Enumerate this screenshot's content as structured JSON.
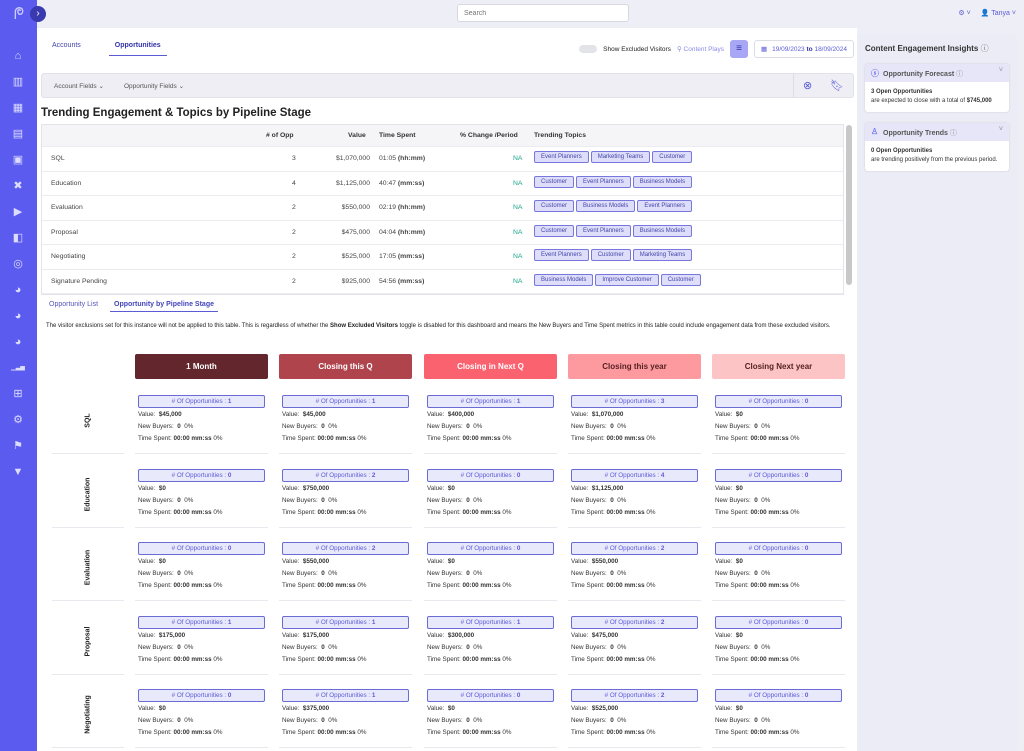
{
  "topbar": {
    "search_placeholder": "Search",
    "user": "Tanya"
  },
  "tabs": [
    {
      "label": "Accounts"
    },
    {
      "label": "Opportunities"
    }
  ],
  "toolbar": {
    "toggle_label": "Show Excluded Visitors",
    "content_plays": "Content Plays",
    "date_from": "19/09/2023",
    "date_to_word": "to",
    "date_to": "18/09/2024"
  },
  "fields": {
    "account": "Account Fields",
    "opportunity": "Opportunity Fields"
  },
  "section_title": "Trending Engagement & Topics by Pipeline Stage",
  "trend_table": {
    "headers": {
      "opp": "# of Opp",
      "value": "Value",
      "time": "Time Spent",
      "change": "% Change /Period",
      "topics": "Trending Topics"
    },
    "rows": [
      {
        "stage": "SQL",
        "opp": "3",
        "value": "$1,070,000",
        "time": "01:05",
        "unit": "(hh:mm)",
        "change": "NA",
        "topics": [
          "Event Planners",
          "Marketing Teams",
          "Customer"
        ]
      },
      {
        "stage": "Education",
        "opp": "4",
        "value": "$1,125,000",
        "time": "40:47",
        "unit": "(mm:ss)",
        "change": "NA",
        "topics": [
          "Customer",
          "Event Planners",
          "Business Models"
        ]
      },
      {
        "stage": "Evaluation",
        "opp": "2",
        "value": "$550,000",
        "time": "02:19",
        "unit": "(hh:mm)",
        "change": "NA",
        "topics": [
          "Customer",
          "Business Models",
          "Event Planners"
        ]
      },
      {
        "stage": "Proposal",
        "opp": "2",
        "value": "$475,000",
        "time": "04:04",
        "unit": "(hh:mm)",
        "change": "NA",
        "topics": [
          "Customer",
          "Event Planners",
          "Business Models"
        ]
      },
      {
        "stage": "Negotiating",
        "opp": "2",
        "value": "$525,000",
        "time": "17:05",
        "unit": "(mm:ss)",
        "change": "NA",
        "topics": [
          "Event Planners",
          "Customer",
          "Marketing Teams"
        ]
      },
      {
        "stage": "Signature Pending",
        "opp": "2",
        "value": "$925,000",
        "time": "54:56",
        "unit": "(mm:ss)",
        "change": "NA",
        "topics": [
          "Business Models",
          "Improve Customer",
          "Customer"
        ]
      }
    ]
  },
  "subtabs": [
    {
      "label": "Opportunity List"
    },
    {
      "label": "Opportunity by Pipeline Stage"
    }
  ],
  "notice": {
    "pre": "The visitor exclusions set for this instance will not be applied to this table. This is regardless of whether the ",
    "bold": "Show Excluded Visitors",
    "post": " toggle is disabled for this dashboard and means the New Buyers and Time Spent metrics in this table could include engagement data from these excluded visitors."
  },
  "pipeline": {
    "labels": {
      "opps": "# Of Opportunities : ",
      "value": "Value:",
      "buyers": "New Buyers:",
      "time": "Time Spent:"
    },
    "columns": [
      {
        "label": "1 Month",
        "bg": "#62262c",
        "fg": "#ffffff"
      },
      {
        "label": "Closing this Q",
        "bg": "#b0444d",
        "fg": "#ffffff"
      },
      {
        "label": "Closing in Next Q",
        "bg": "#fb6270",
        "fg": "#ffffff"
      },
      {
        "label": "Closing this year",
        "bg": "#fd9aa0",
        "fg": "#552222"
      },
      {
        "label": "Closing Next year",
        "bg": "#fdc4c6",
        "fg": "#552222"
      }
    ],
    "rows": [
      {
        "stage": "SQL",
        "cells": [
          {
            "opps": "1",
            "value": "$45,000",
            "buyers": "0",
            "buyers_pct": "0%",
            "time": "00:00 mm:ss",
            "time_pct": "0%"
          },
          {
            "opps": "1",
            "value": "$45,000",
            "buyers": "0",
            "buyers_pct": "0%",
            "time": "00:00 mm:ss",
            "time_pct": "0%"
          },
          {
            "opps": "1",
            "value": "$400,000",
            "buyers": "0",
            "buyers_pct": "0%",
            "time": "00:00 mm:ss",
            "time_pct": "0%"
          },
          {
            "opps": "3",
            "value": "$1,070,000",
            "buyers": "0",
            "buyers_pct": "0%",
            "time": "00:00 mm:ss",
            "time_pct": "0%"
          },
          {
            "opps": "0",
            "value": "$0",
            "buyers": "0",
            "buyers_pct": "0%",
            "time": "00:00 mm:ss",
            "time_pct": "0%"
          }
        ]
      },
      {
        "stage": "Education",
        "cells": [
          {
            "opps": "0",
            "value": "$0",
            "buyers": "0",
            "buyers_pct": "0%",
            "time": "00:00 mm:ss",
            "time_pct": "0%"
          },
          {
            "opps": "2",
            "value": "$750,000",
            "buyers": "0",
            "buyers_pct": "0%",
            "time": "00:00 mm:ss",
            "time_pct": "0%"
          },
          {
            "opps": "0",
            "value": "$0",
            "buyers": "0",
            "buyers_pct": "0%",
            "time": "00:00 mm:ss",
            "time_pct": "0%"
          },
          {
            "opps": "4",
            "value": "$1,125,000",
            "buyers": "0",
            "buyers_pct": "0%",
            "time": "00:00 mm:ss",
            "time_pct": "0%"
          },
          {
            "opps": "0",
            "value": "$0",
            "buyers": "0",
            "buyers_pct": "0%",
            "time": "00:00 mm:ss",
            "time_pct": "0%"
          }
        ]
      },
      {
        "stage": "Evaluation",
        "cells": [
          {
            "opps": "0",
            "value": "$0",
            "buyers": "0",
            "buyers_pct": "0%",
            "time": "00:00 mm:ss",
            "time_pct": "0%"
          },
          {
            "opps": "2",
            "value": "$550,000",
            "buyers": "0",
            "buyers_pct": "0%",
            "time": "00:00 mm:ss",
            "time_pct": "0%"
          },
          {
            "opps": "0",
            "value": "$0",
            "buyers": "0",
            "buyers_pct": "0%",
            "time": "00:00 mm:ss",
            "time_pct": "0%"
          },
          {
            "opps": "2",
            "value": "$550,000",
            "buyers": "0",
            "buyers_pct": "0%",
            "time": "00:00 mm:ss",
            "time_pct": "0%"
          },
          {
            "opps": "0",
            "value": "$0",
            "buyers": "0",
            "buyers_pct": "0%",
            "time": "00:00 mm:ss",
            "time_pct": "0%"
          }
        ]
      },
      {
        "stage": "Proposal",
        "cells": [
          {
            "opps": "1",
            "value": "$175,000",
            "buyers": "0",
            "buyers_pct": "0%",
            "time": "00:00 mm:ss",
            "time_pct": "0%"
          },
          {
            "opps": "1",
            "value": "$175,000",
            "buyers": "0",
            "buyers_pct": "0%",
            "time": "00:00 mm:ss",
            "time_pct": "0%"
          },
          {
            "opps": "1",
            "value": "$300,000",
            "buyers": "0",
            "buyers_pct": "0%",
            "time": "00:00 mm:ss",
            "time_pct": "0%"
          },
          {
            "opps": "2",
            "value": "$475,000",
            "buyers": "0",
            "buyers_pct": "0%",
            "time": "00:00 mm:ss",
            "time_pct": "0%"
          },
          {
            "opps": "0",
            "value": "$0",
            "buyers": "0",
            "buyers_pct": "0%",
            "time": "00:00 mm:ss",
            "time_pct": "0%"
          }
        ]
      },
      {
        "stage": "Negotiating",
        "cells": [
          {
            "opps": "0",
            "value": "$0",
            "buyers": "0",
            "buyers_pct": "0%",
            "time": "00:00 mm:ss",
            "time_pct": "0%"
          },
          {
            "opps": "1",
            "value": "$375,000",
            "buyers": "0",
            "buyers_pct": "0%",
            "time": "00:00 mm:ss",
            "time_pct": "0%"
          },
          {
            "opps": "0",
            "value": "$0",
            "buyers": "0",
            "buyers_pct": "0%",
            "time": "00:00 mm:ss",
            "time_pct": "0%"
          },
          {
            "opps": "2",
            "value": "$525,000",
            "buyers": "0",
            "buyers_pct": "0%",
            "time": "00:00 mm:ss",
            "time_pct": "0%"
          },
          {
            "opps": "0",
            "value": "$0",
            "buyers": "0",
            "buyers_pct": "0%",
            "time": "00:00 mm:ss",
            "time_pct": "0%"
          }
        ]
      }
    ]
  },
  "insights": {
    "title": "Content Engagement Insights",
    "forecast": {
      "title": "Opportunity Forecast",
      "bold": "3 Open Opportunities",
      "text": "are expected to close with a total of ",
      "amount": "$745,000"
    },
    "trends": {
      "title": "Opportunity Trends",
      "bold": "0 Open Opportunities",
      "text": "are trending positively from the previous period."
    }
  },
  "icons": {
    "sidebar": [
      "home-icon",
      "buildings-icon",
      "grid-icon",
      "keyboard-icon",
      "browser-window-icon",
      "tools-icon",
      "video-icon",
      "chat-icon",
      "target-icon",
      "pie-chart-icon",
      "pie-chart-icon",
      "pie-chart-icon",
      "bar-chart-icon",
      "report-add-icon",
      "document-settings-icon",
      "bookmark-icon",
      "filter-icon"
    ]
  }
}
